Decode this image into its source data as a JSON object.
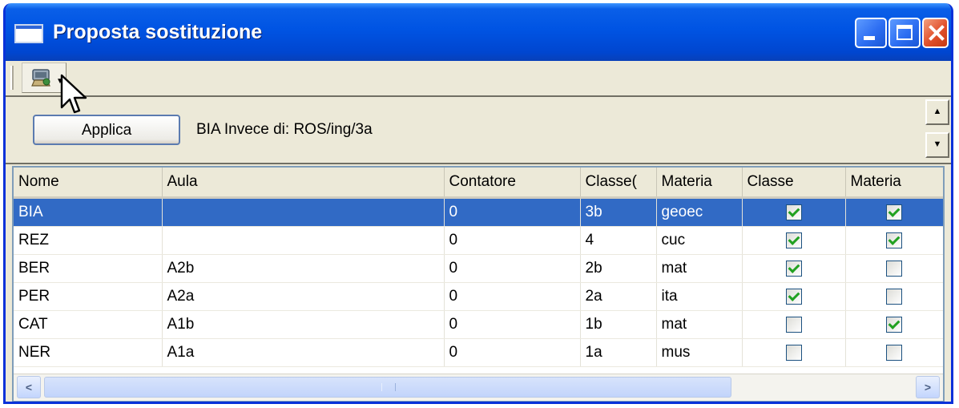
{
  "window": {
    "title": "Proposta sostituzione"
  },
  "toolbar": {
    "tool_icon": "assign-teacher-icon",
    "dropdown_icon": "dropdown-arrow-icon"
  },
  "action": {
    "button_label": "Applica",
    "info_text": "BIA Invece di: ROS/ing/3a"
  },
  "grid": {
    "columns": [
      "Nome",
      "Aula",
      "Contatore",
      "Classe(",
      "Materia",
      "Classe",
      "Materia"
    ],
    "rows": [
      {
        "nome": "BIA",
        "aula": "",
        "contatore": "0",
        "classe_orig": "3b",
        "materia": "geoec",
        "classe_chk": true,
        "materia_chk": true,
        "selected": true
      },
      {
        "nome": "REZ",
        "aula": "",
        "contatore": "0",
        "classe_orig": "4",
        "materia": "cuc",
        "classe_chk": true,
        "materia_chk": true,
        "selected": false
      },
      {
        "nome": "BER",
        "aula": "A2b",
        "contatore": "0",
        "classe_orig": "2b",
        "materia": "mat",
        "classe_chk": true,
        "materia_chk": false,
        "selected": false
      },
      {
        "nome": "PER",
        "aula": "A2a",
        "contatore": "0",
        "classe_orig": "2a",
        "materia": "ita",
        "classe_chk": true,
        "materia_chk": false,
        "selected": false
      },
      {
        "nome": "CAT",
        "aula": "A1b",
        "contatore": "0",
        "classe_orig": "1b",
        "materia": "mat",
        "classe_chk": false,
        "materia_chk": true,
        "selected": false
      },
      {
        "nome": "NER",
        "aula": "A1a",
        "contatore": "0",
        "classe_orig": "1a",
        "materia": "mus",
        "classe_chk": false,
        "materia_chk": false,
        "selected": false
      }
    ]
  },
  "colors": {
    "titlebar": "#0054e3",
    "selection": "#316ac5",
    "check": "#21a121",
    "face": "#ece9d8"
  }
}
